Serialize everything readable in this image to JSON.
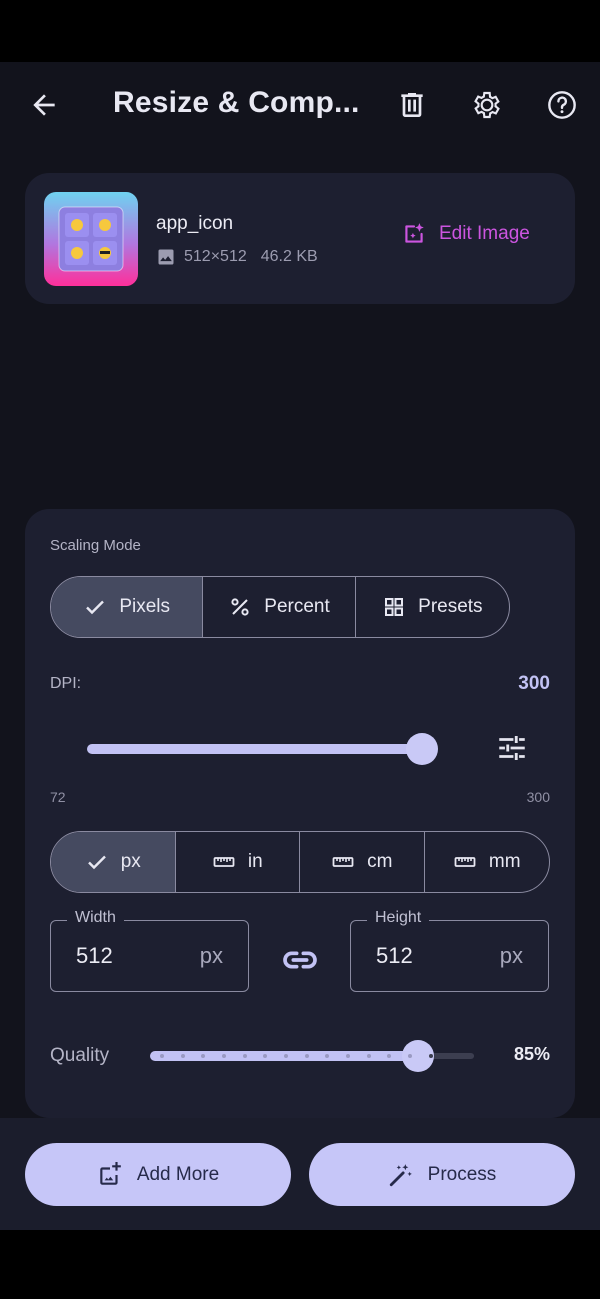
{
  "app_bar": {
    "title": "Resize & Comp...",
    "back_icon": "arrow-back-icon",
    "actions": [
      "delete-icon",
      "settings-gear-icon",
      "help-icon"
    ]
  },
  "image": {
    "name": "app_icon",
    "dimensions": "512×512",
    "size": "46.2 KB",
    "edit_label": "Edit Image"
  },
  "scaling": {
    "section_label": "Scaling Mode",
    "modes": [
      {
        "label": "Pixels",
        "icon": "check-icon",
        "active": true
      },
      {
        "label": "Percent",
        "icon": "percent-icon",
        "active": false
      },
      {
        "label": "Presets",
        "icon": "grid-icon",
        "active": false
      }
    ],
    "dpi_label": "DPI:",
    "dpi_value": "300",
    "dpi_min": "72",
    "dpi_max": "300",
    "dpi_fraction": 1.0,
    "units": [
      {
        "label": "px",
        "icon": "check-icon",
        "active": true
      },
      {
        "label": "in",
        "icon": "ruler-icon",
        "active": false
      },
      {
        "label": "cm",
        "icon": "ruler-icon",
        "active": false
      },
      {
        "label": "mm",
        "icon": "ruler-icon",
        "active": false
      }
    ],
    "width": {
      "label": "Width",
      "value": "512",
      "unit": "px"
    },
    "height": {
      "label": "Height",
      "value": "512",
      "unit": "px"
    },
    "quality_label": "Quality",
    "quality_value": "85%",
    "quality_fraction": 0.85
  },
  "bottom": {
    "add_more": "Add More",
    "process": "Process"
  },
  "colors": {
    "background": "#12131c",
    "card": "#1d1f30",
    "accent": "#c2c2f4",
    "edit_accent": "#cc55e0",
    "button": "#c6c6f8"
  }
}
